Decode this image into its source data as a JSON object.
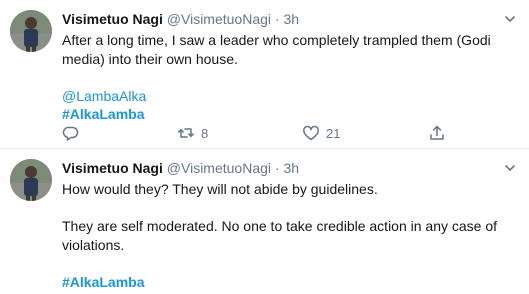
{
  "tweets": [
    {
      "name": "Visimetuo Nagi",
      "handle": "@VisimetuoNagi",
      "separator": "·",
      "time": "3h",
      "lines": [
        "After a long time, I saw a leader who completely trampled them (Godi",
        "media) into their own house."
      ],
      "mention": "@LambaAlka",
      "hashtag": "#AlkaLamba",
      "retweets": "8",
      "likes": "21"
    },
    {
      "name": "Visimetuo Nagi",
      "handle": "@VisimetuoNagi",
      "separator": "·",
      "time": "3h",
      "line1": "How would they? They will not abide by guidelines.",
      "line2": "They are self moderated. No one to take credible action in any case of",
      "line3": "violations.",
      "hashtag": "#AlkaLamba"
    }
  ],
  "icons": {
    "reply": "reply-icon",
    "retweet": "retweet-icon",
    "like": "heart-icon",
    "share": "share-icon",
    "caret": "chevron-down-icon"
  },
  "colors": {
    "link": "#1b95e0",
    "muted": "#657786",
    "text": "#14171a",
    "divider": "#e6ecf0"
  }
}
